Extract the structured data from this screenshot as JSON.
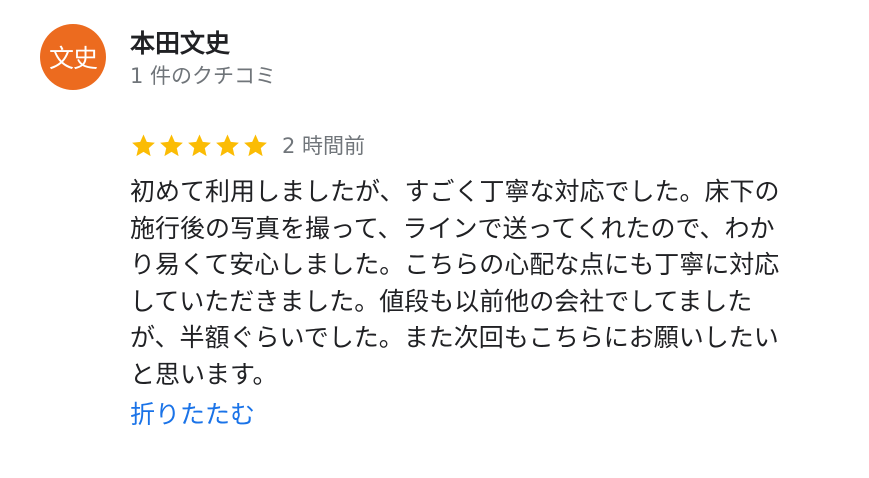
{
  "review": {
    "avatar_text": "文史",
    "avatar_color": "#ec6b1f",
    "author_name": "本田文史",
    "review_count": "1 件のクチコミ",
    "rating": 5,
    "rating_max": 5,
    "star_color": "#fbbc04",
    "time": "2 時間前",
    "text_lines": [
      "初めて利用しましたが、すごく丁寧な対応でした。床下の",
      "施行後の写真を撮って、ラインで送ってくれたので、わか",
      "り易くて安心しました。こちらの心配な点にも丁寧に対応",
      "していただきました。値段も以前他の会社でしてました",
      "が、半額ぐらいでした。また次回もこちらにお願いしたい",
      "と思います。"
    ],
    "collapse_label": "折りたたむ",
    "link_color": "#1a73e8"
  }
}
